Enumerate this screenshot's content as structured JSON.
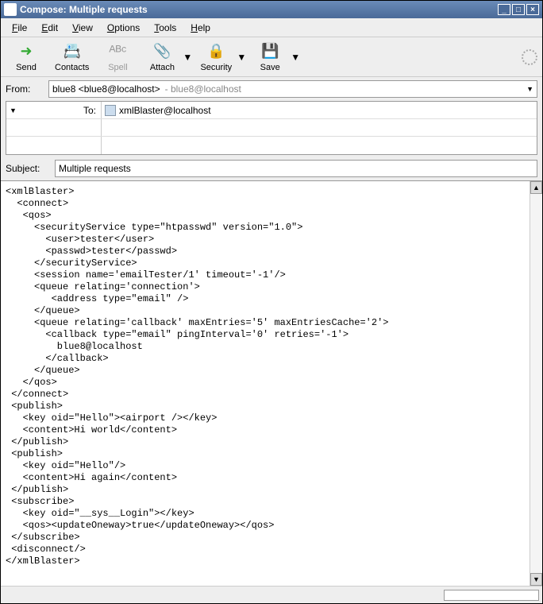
{
  "window": {
    "title": "Compose: Multiple requests"
  },
  "menubar": {
    "file": "File",
    "edit": "Edit",
    "view": "View",
    "options": "Options",
    "tools": "Tools",
    "help": "Help"
  },
  "toolbar": {
    "send": "Send",
    "contacts": "Contacts",
    "spell": "Spell",
    "attach": "Attach",
    "security": "Security",
    "save": "Save"
  },
  "headers": {
    "from_label": "From:",
    "from_value": "blue8 <blue8@localhost>",
    "from_grey": " - blue8@localhost",
    "to_label": "To:",
    "to_value": "xmlBlaster@localhost",
    "subject_label": "Subject:",
    "subject_value": "Multiple requests"
  },
  "body": "<xmlBlaster>\n  <connect>\n   <qos>\n     <securityService type=\"htpasswd\" version=\"1.0\">\n       <user>tester</user>\n       <passwd>tester</passwd>\n     </securityService>\n     <session name='emailTester/1' timeout='-1'/>\n     <queue relating='connection'>\n        <address type=\"email\" />\n     </queue>\n     <queue relating='callback' maxEntries='5' maxEntriesCache='2'>\n       <callback type=\"email\" pingInterval='0' retries='-1'>\n         blue8@localhost\n       </callback>\n     </queue>\n   </qos>\n </connect>\n <publish>\n   <key oid=\"Hello\"><airport /></key>\n   <content>Hi world</content>\n </publish>\n <publish>\n   <key oid=\"Hello\"/>\n   <content>Hi again</content>\n </publish>\n <subscribe>\n   <key oid=\"__sys__Login\"></key>\n   <qos><updateOneway>true</updateOneway></qos>\n </subscribe>\n <disconnect/>\n</xmlBlaster>"
}
